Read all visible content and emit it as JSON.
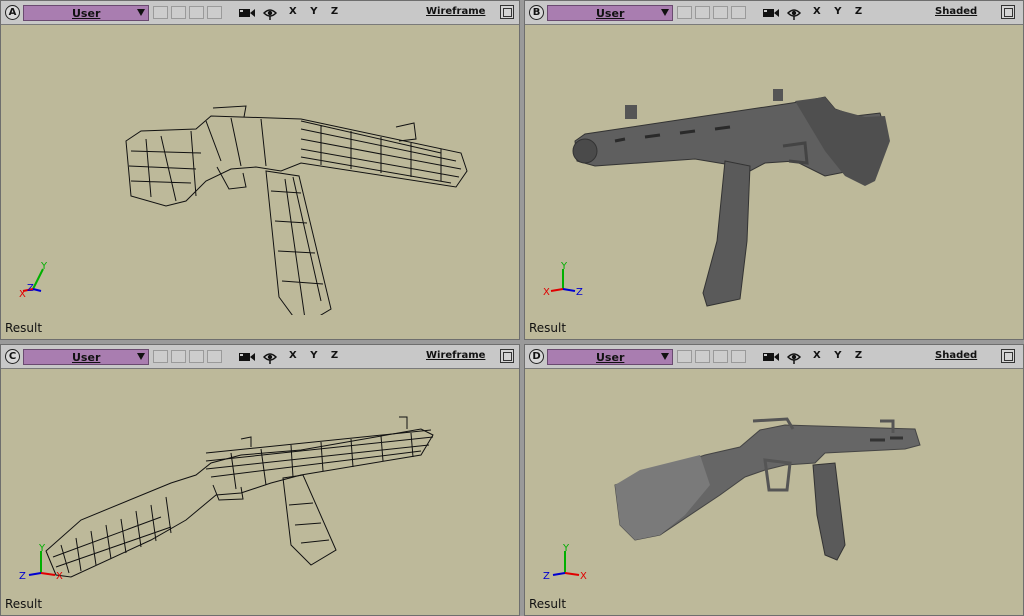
{
  "viewports": [
    {
      "letter": "A",
      "camera": "User",
      "mode": "Wireframe",
      "axes": "X Y Z",
      "result": "Result",
      "render": "wire",
      "gizmo": {
        "left": "X",
        "mid": "Z",
        "up": "Y"
      }
    },
    {
      "letter": "B",
      "camera": "User",
      "mode": "Shaded",
      "axes": "X Y Z",
      "result": "Result",
      "render": "shaded",
      "gizmo": {
        "left": "X",
        "mid": "Z",
        "up": "Y"
      }
    },
    {
      "letter": "C",
      "camera": "User",
      "mode": "Wireframe",
      "axes": "X Y Z",
      "result": "Result",
      "render": "wire",
      "gizmo": {
        "left": "Z",
        "mid": "X",
        "up": "Y"
      }
    },
    {
      "letter": "D",
      "camera": "User",
      "mode": "Shaded",
      "axes": "X Y Z",
      "result": "Result",
      "render": "shaded",
      "gizmo": {
        "left": "Z",
        "mid": "X",
        "up": "Y"
      }
    }
  ],
  "colors": {
    "viewport_bg": "#bdb99a",
    "camera_select": "#a97db0",
    "wire": "#111111",
    "shaded": "#5f5f5f",
    "axis_x": "#e00000",
    "axis_y": "#00b000",
    "axis_z": "#0000d0"
  }
}
